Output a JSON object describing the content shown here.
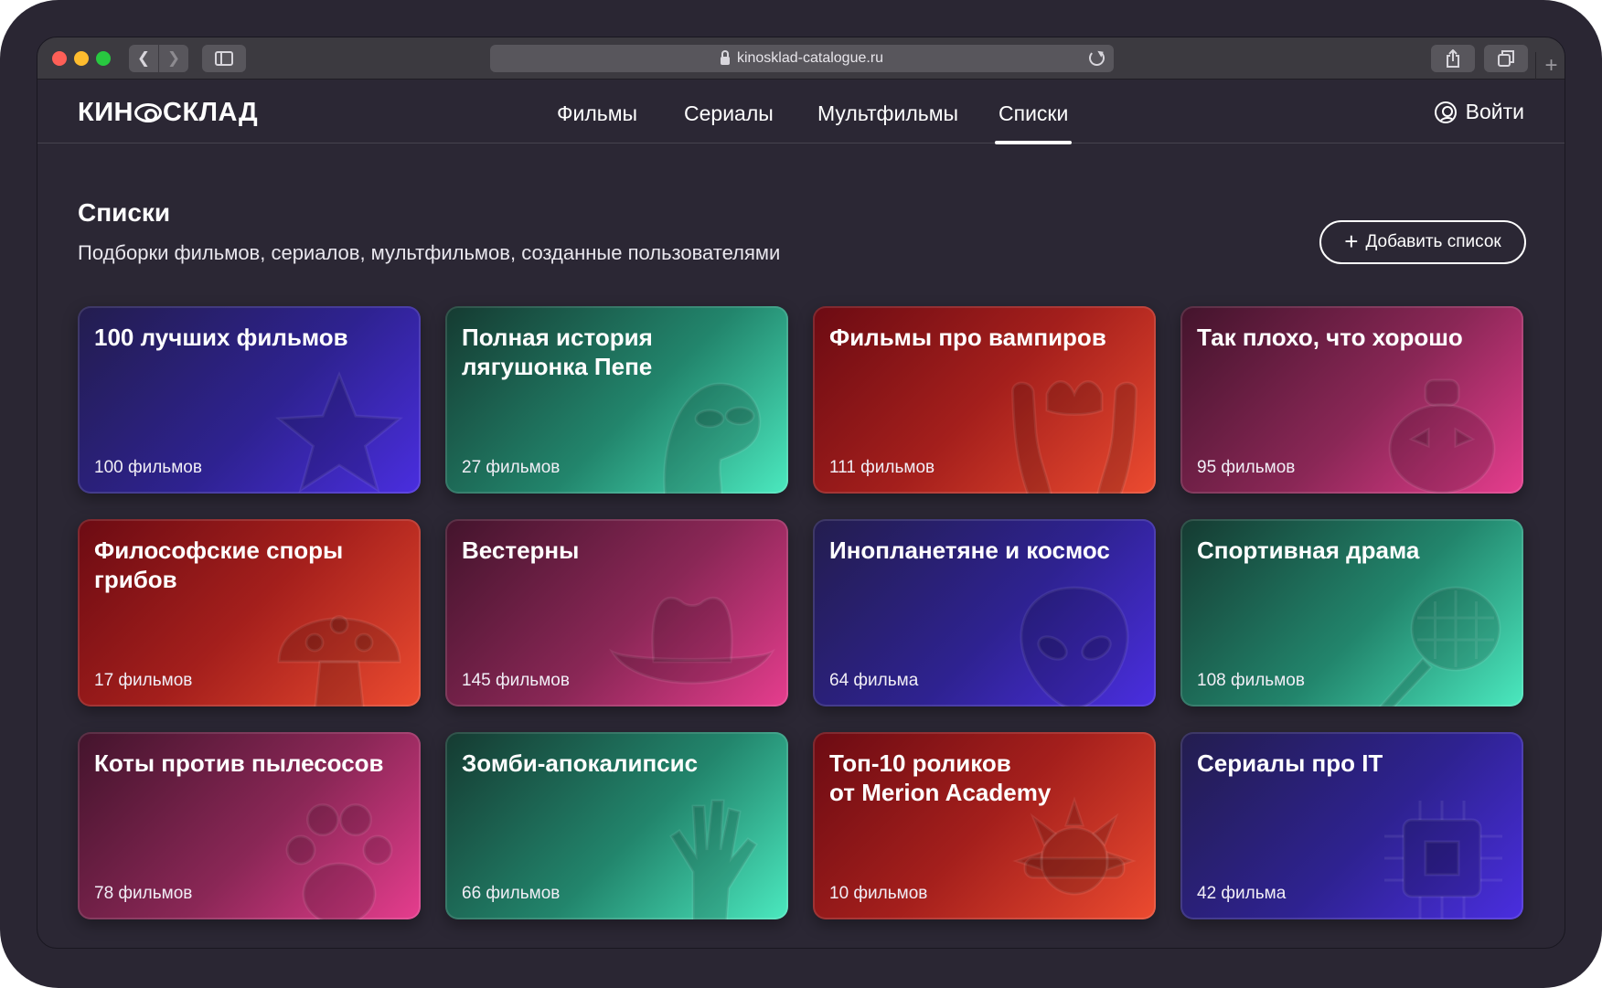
{
  "browser": {
    "url": "kinosklad-catalogue.ru"
  },
  "header": {
    "logo": {
      "left": "КИН",
      "right": "СКЛАД"
    },
    "nav": [
      {
        "label": "Фильмы",
        "active": false
      },
      {
        "label": "Сериалы",
        "active": false
      },
      {
        "label": "Мультфильмы",
        "active": false
      },
      {
        "label": "Списки",
        "active": true
      }
    ],
    "login_label": "Войти"
  },
  "page": {
    "title": "Списки",
    "subtitle": "Подборки фильмов, сериалов, мультфильмов, созданные пользователями",
    "add_button_label": "Добавить список"
  },
  "colors": {
    "background": "#2b2734",
    "blue": "#4a2ee0",
    "green": "#4be9bf",
    "red": "#ec4b30",
    "pink": "#e63d8e"
  },
  "cards": [
    {
      "title": "100 лучших фильмов",
      "count": "100 фильмов",
      "theme": "blue",
      "icon": "star-icon"
    },
    {
      "title": "Полная история\nлягушонка Пепе",
      "count": "27 фильмов",
      "theme": "green",
      "icon": "frog-icon"
    },
    {
      "title": "Фильмы про вампиров",
      "count": "111 фильмов",
      "theme": "red",
      "icon": "vampire-fangs-icon"
    },
    {
      "title": "Так плохо, что хорошо",
      "count": "95 фильмов",
      "theme": "pink",
      "icon": "sad-pumpkin-icon"
    },
    {
      "title": "Философские споры\nгрибов",
      "count": "17 фильмов",
      "theme": "red",
      "icon": "mushroom-icon"
    },
    {
      "title": "Вестерны",
      "count": "145 фильмов",
      "theme": "pink",
      "icon": "cowboy-hat-icon"
    },
    {
      "title": "Инопланетяне и космос",
      "count": "64 фильма",
      "theme": "blue",
      "icon": "alien-icon"
    },
    {
      "title": "Спортивная драма",
      "count": "108 фильмов",
      "theme": "green",
      "icon": "tennis-racket-icon"
    },
    {
      "title": "Коты против пылесосов",
      "count": "78 фильмов",
      "theme": "pink",
      "icon": "paw-icon"
    },
    {
      "title": "Зомби-апокалипсис",
      "count": "66 фильмов",
      "theme": "green",
      "icon": "zombie-hand-icon"
    },
    {
      "title": "Топ-10 роликов\nот Merion Academy",
      "count": "10 фильмов",
      "theme": "red",
      "icon": "sun-glasses-icon"
    },
    {
      "title": "Сериалы про IT",
      "count": "42 фильма",
      "theme": "blue",
      "icon": "chip-icon"
    }
  ]
}
